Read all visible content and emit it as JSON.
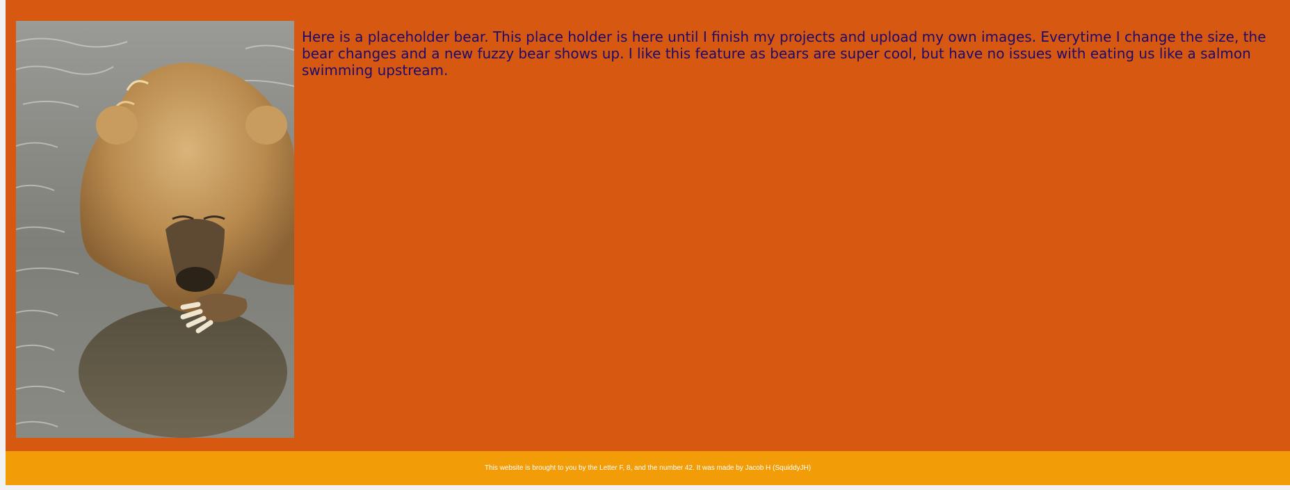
{
  "main": {
    "background_color": "#d75811",
    "text_color": "#1c0a6e",
    "intro_text": "Here is a placeholder bear. This place holder is here until I finish my projects and upload my own images. Everytime I change the size, the bear changes and a new fuzzy bear shows up. I like this feature as bears are super cool, but have no issues with eating us like a salmon swimming upstream.",
    "image": {
      "subject": "bear-photo"
    }
  },
  "footer": {
    "background_color": "#f29d08",
    "text": "This website is brought to you by the Letter F, 8, and the number 42. It was made by Jacob H (SquiddyJH)"
  }
}
